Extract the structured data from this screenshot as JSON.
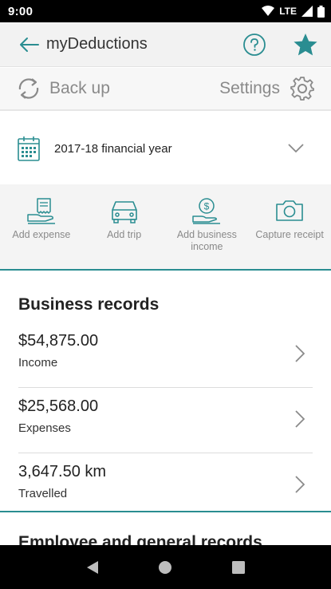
{
  "status_bar": {
    "time": "9:00",
    "network": "LTE"
  },
  "app_bar": {
    "title": "myDeductions"
  },
  "backup_bar": {
    "backup_label": "Back up",
    "settings_label": "Settings"
  },
  "year_selector": {
    "label": "2017-18 financial year"
  },
  "actions": [
    {
      "label": "Add expense",
      "icon": "receipt-hand-icon"
    },
    {
      "label": "Add trip",
      "icon": "car-icon"
    },
    {
      "label": "Add business income",
      "icon": "coin-hand-icon"
    },
    {
      "label": "Capture receipt",
      "icon": "camera-icon"
    }
  ],
  "business_records": {
    "title": "Business records",
    "items": [
      {
        "value": "$54,875.00",
        "label": "Income"
      },
      {
        "value": "$25,568.00",
        "label": "Expenses"
      },
      {
        "value": "3,647.50 km",
        "label": "Travelled"
      }
    ]
  },
  "next_section": {
    "title": "Employee and general records"
  },
  "colors": {
    "accent": "#2a8d91",
    "muted": "#8a8a8a",
    "app_bar_bg": "#f2f2f2"
  }
}
